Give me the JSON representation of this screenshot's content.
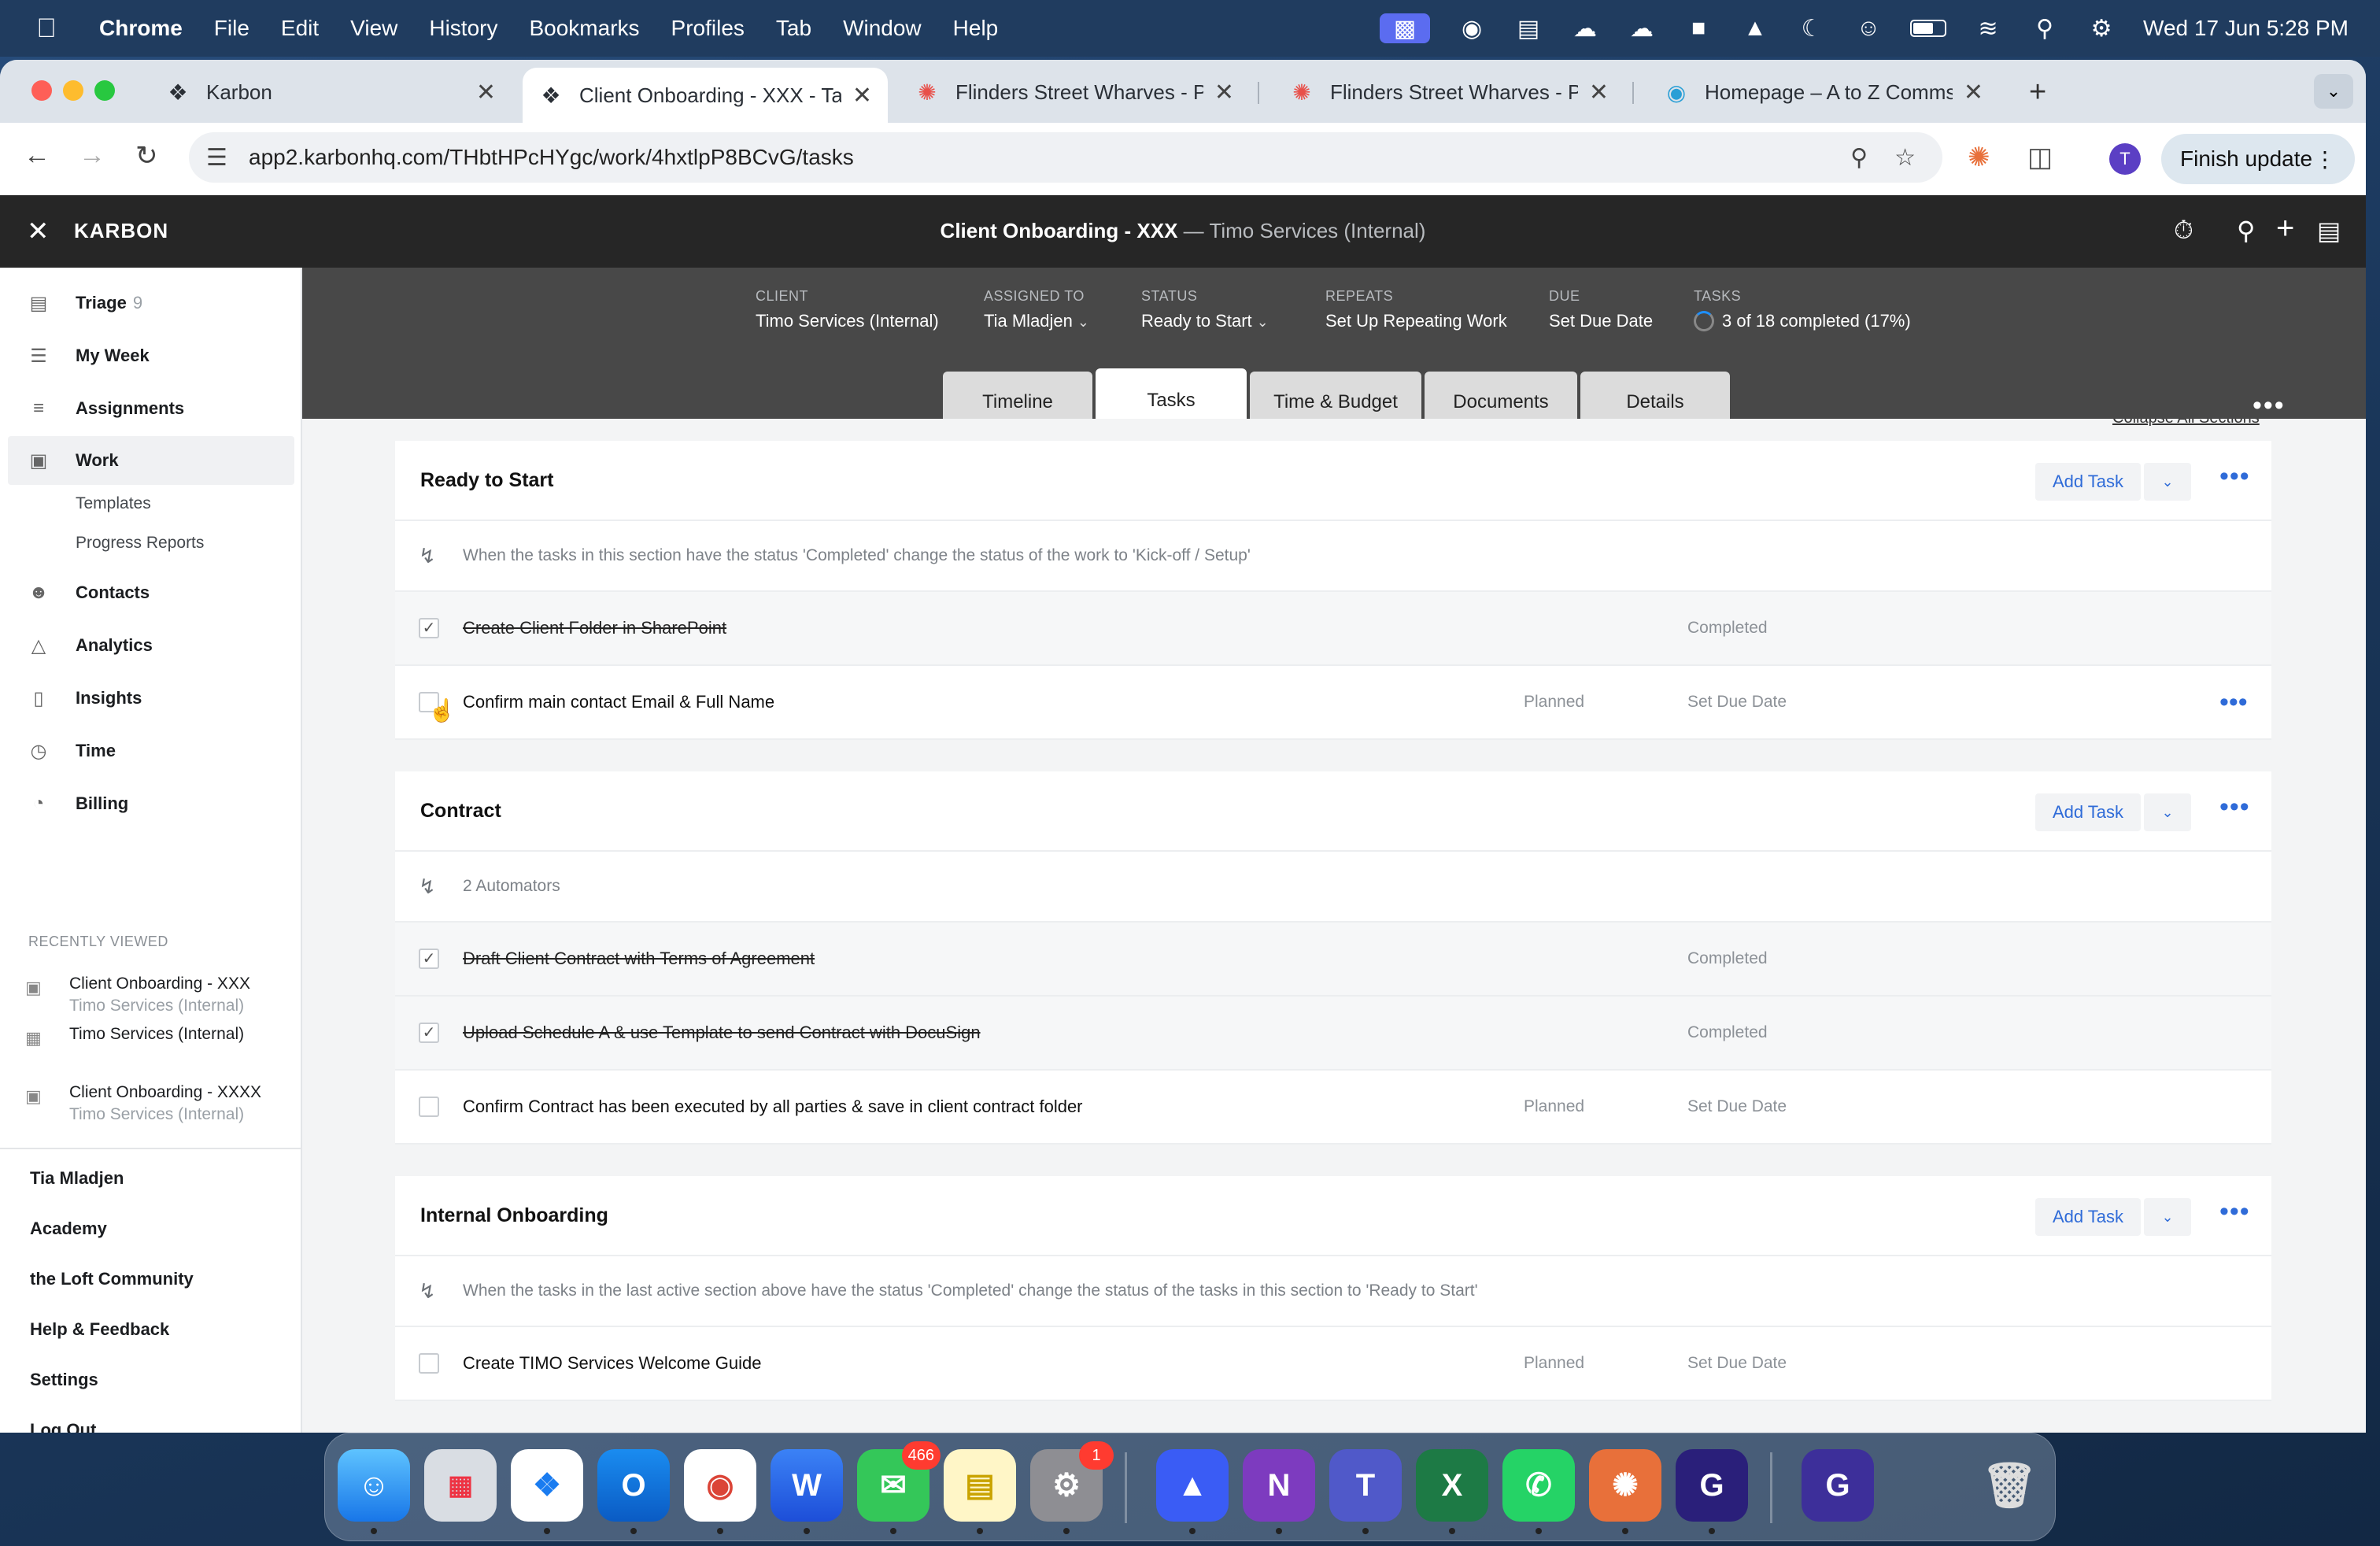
{
  "menubar": {
    "app": "Chrome",
    "items": [
      "File",
      "Edit",
      "View",
      "History",
      "Bookmarks",
      "Profiles",
      "Tab",
      "Window",
      "Help"
    ],
    "clock": "Wed 17 Jun  5:28 PM"
  },
  "browser": {
    "tabs": [
      {
        "title": "Karbon",
        "icon": "karbon-logo-icon"
      },
      {
        "title": "Client Onboarding - XXX - Ta",
        "icon": "karbon-logo-icon"
      },
      {
        "title": "Flinders Street Wharves - Pov",
        "icon": "power-automate-icon"
      },
      {
        "title": "Flinders Street Wharves - Pov",
        "icon": "power-automate-icon"
      },
      {
        "title": "Homepage – A to Z Comms &",
        "icon": "site-icon"
      }
    ],
    "url": "app2.karbonhq.com/THbtHPcHYgc/work/4hxtlpP8BCvG/tasks",
    "profile_initial": "T",
    "finish_update": "Finish update"
  },
  "app": {
    "brand": "KARBON",
    "work_title": "Client Onboarding - XXX",
    "work_sep": " — ",
    "work_client": "Timo Services (Internal)"
  },
  "sidebar": {
    "nav": [
      {
        "label": "Triage",
        "count": "9",
        "icon": "triage-icon"
      },
      {
        "label": "My Week",
        "icon": "list-icon"
      },
      {
        "label": "Assignments",
        "icon": "assignments-icon"
      },
      {
        "label": "Work",
        "icon": "briefcase-icon",
        "selected": true
      },
      {
        "label": "Contacts",
        "icon": "contacts-icon"
      },
      {
        "label": "Analytics",
        "icon": "analytics-icon"
      },
      {
        "label": "Insights",
        "icon": "insights-icon"
      },
      {
        "label": "Time",
        "icon": "clock-icon"
      },
      {
        "label": "Billing",
        "icon": "billing-icon"
      }
    ],
    "work_sub": [
      "Templates",
      "Progress Reports"
    ],
    "recently_viewed_label": "RECENTLY VIEWED",
    "recent": [
      {
        "title": "Client Onboarding - XXX",
        "sub": "Timo Services (Internal)"
      },
      {
        "title": "Timo Services (Internal)",
        "sub": ""
      },
      {
        "title": "Client Onboarding - XXXX",
        "sub": "Timo Services (Internal)"
      }
    ],
    "footer": [
      "Tia Mladjen",
      "Academy",
      "the Loft Community",
      "Help & Feedback",
      "Settings",
      "Log Out"
    ]
  },
  "work_meta": {
    "client_label": "CLIENT",
    "client": "Timo Services (Internal)",
    "assigned_label": "ASSIGNED TO",
    "assigned": "Tia Mladjen",
    "status_label": "STATUS",
    "status": "Ready to Start",
    "repeats_label": "REPEATS",
    "repeats": "Set Up Repeating Work",
    "due_label": "DUE",
    "due": "Set Due Date",
    "tasks_label": "TASKS",
    "tasks": "3 of 18 completed (17%)"
  },
  "work_tabs": [
    "Timeline",
    "Tasks",
    "Time & Budget",
    "Documents",
    "Details"
  ],
  "collapse_all": "Collapse All Sections",
  "sections": [
    {
      "title": "Ready to Start",
      "add_task": "Add Task",
      "automation": "When the tasks in this section have the status 'Completed' change the status of the work to 'Kick-off / Setup'",
      "tasks": [
        {
          "name": "Create Client Folder in SharePoint",
          "status": "",
          "due": "Completed",
          "done": true
        },
        {
          "name": "Confirm main contact Email & Full Name",
          "status": "Planned",
          "due": "Set Due Date",
          "done": false
        }
      ]
    },
    {
      "title": "Contract",
      "add_task": "Add Task",
      "automation": "2 Automators",
      "tasks": [
        {
          "name": "Draft Client Contract with Terms of Agreement",
          "status": "",
          "due": "Completed",
          "done": true
        },
        {
          "name": "Upload Schedule A & use Template to send Contract with DocuSign",
          "status": "",
          "due": "Completed",
          "done": true
        },
        {
          "name": "Confirm Contract has been executed by all parties & save in client contract folder",
          "status": "Planned",
          "due": "Set Due Date",
          "done": false
        }
      ]
    },
    {
      "title": "Internal Onboarding",
      "add_task": "Add Task",
      "automation": "When the tasks in the last active section above have the status 'Completed' change the status of the tasks in this section to 'Ready to Start'",
      "tasks": [
        {
          "name": "Create TIMO Services Welcome Guide",
          "status": "Planned",
          "due": "Set Due Date",
          "done": false
        }
      ]
    }
  ],
  "dock": {
    "messages_badge": "466",
    "settings_badge": "1"
  }
}
